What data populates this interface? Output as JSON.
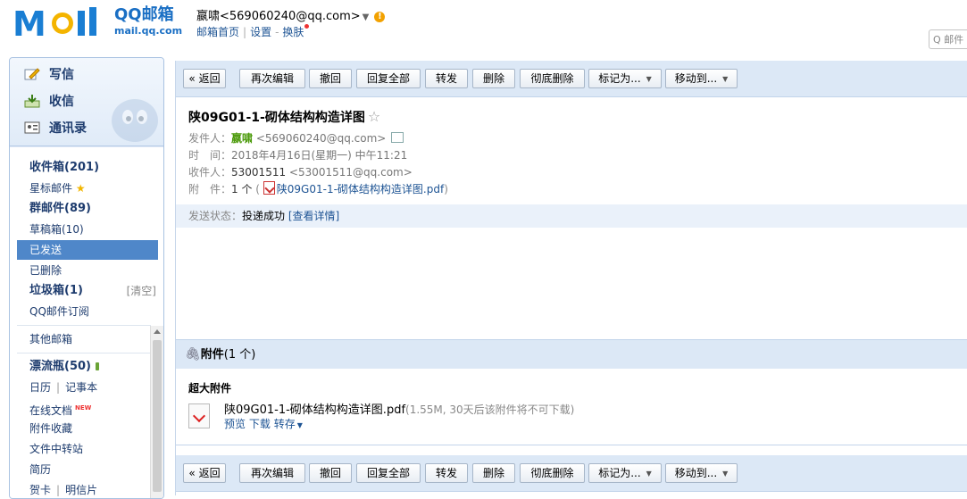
{
  "header": {
    "logo_text": "MOil",
    "brand": "QQ邮箱",
    "domain": "mail.qq.com",
    "user": "嬴啸<569060240@qq.com>",
    "links": [
      "邮箱首页",
      "设置",
      "换肤"
    ],
    "search_placeholder": "Q 邮件"
  },
  "sidebar": {
    "quick": [
      "写信",
      "收信",
      "通讯录"
    ],
    "folders": [
      {
        "label": "收件箱(201)",
        "bold": true
      },
      {
        "label": "星标邮件"
      },
      {
        "label": "群邮件(89)",
        "bold": true
      },
      {
        "label": "草稿箱(10)"
      },
      {
        "label": "已发送",
        "selected": true
      },
      {
        "label": "已删除"
      },
      {
        "label": "垃圾箱(1)",
        "bold": true,
        "extra": "[清空]"
      },
      {
        "label": "QQ邮件订阅"
      }
    ],
    "others": {
      "other_mailbox": "其他邮箱",
      "drift_bottle": "漂流瓶(50)",
      "calendar": "日历",
      "notes": "记事本",
      "online_docs": "在线文档",
      "new_badge": "NEW",
      "attachments": "附件收藏",
      "file_transfer": "文件中转站",
      "resume": "简历",
      "greeting_card": "贺卡",
      "postcard": "明信片"
    }
  },
  "toolbar": {
    "back": "« 返回",
    "edit_again": "再次编辑",
    "recall": "撤回",
    "reply_all": "回复全部",
    "forward": "转发",
    "delete": "删除",
    "delete_forever": "彻底删除",
    "mark_as": "标记为...",
    "move_to": "移动到..."
  },
  "mail": {
    "subject": "陕09G01-1-砌体结构构造详图",
    "from_label": "发件人：",
    "from_name": "嬴啸",
    "from_addr": "<569060240@qq.com>",
    "time_label": "时　间：",
    "time_value": "2018年4月16日(星期一) 中午11:21",
    "to_label": "收件人：",
    "to_name": "53001511",
    "to_addr": "<53001511@qq.com>",
    "att_label": "附　件：",
    "att_count": "1 个",
    "att_file": "陕09G01-1-砌体结构构造详图.pdf",
    "status_label": "发送状态：",
    "status_value": "投递成功",
    "status_link": "[查看详情]"
  },
  "attachments": {
    "title": "附件",
    "count": "(1 个)",
    "section": "超大附件",
    "file": "陕09G01-1-砌体结构构造详图.pdf",
    "note": "(1.55M, 30天后该附件将不可下载)",
    "actions": [
      "预览",
      "下载",
      "转存"
    ]
  }
}
